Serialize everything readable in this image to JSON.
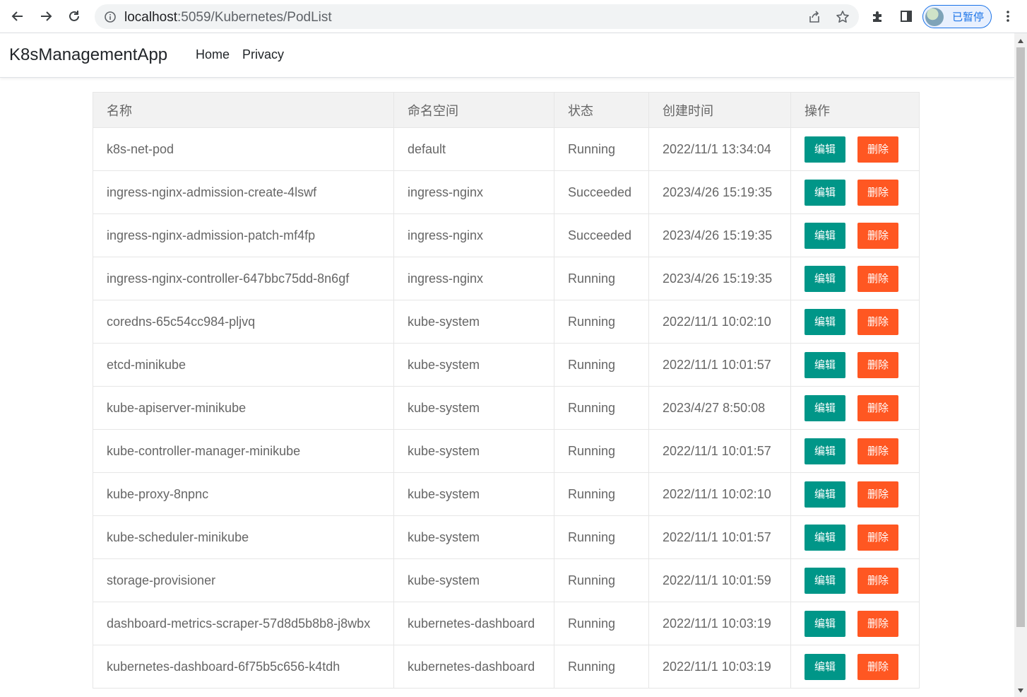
{
  "browser": {
    "url_host": "localhost",
    "url_path": ":5059/Kubernetes/PodList",
    "profile_label": "已暂停"
  },
  "navbar": {
    "brand": "K8sManagementApp",
    "links": [
      "Home",
      "Privacy"
    ]
  },
  "table": {
    "headers": [
      "名称",
      "命名空间",
      "状态",
      "创建时间",
      "操作"
    ],
    "edit_label": "编辑",
    "delete_label": "删除",
    "rows": [
      {
        "name": "k8s-net-pod",
        "namespace": "default",
        "status": "Running",
        "created": "2022/11/1 13:34:04"
      },
      {
        "name": "ingress-nginx-admission-create-4lswf",
        "namespace": "ingress-nginx",
        "status": "Succeeded",
        "created": "2023/4/26 15:19:35"
      },
      {
        "name": "ingress-nginx-admission-patch-mf4fp",
        "namespace": "ingress-nginx",
        "status": "Succeeded",
        "created": "2023/4/26 15:19:35"
      },
      {
        "name": "ingress-nginx-controller-647bbc75dd-8n6gf",
        "namespace": "ingress-nginx",
        "status": "Running",
        "created": "2023/4/26 15:19:35"
      },
      {
        "name": "coredns-65c54cc984-pljvq",
        "namespace": "kube-system",
        "status": "Running",
        "created": "2022/11/1 10:02:10"
      },
      {
        "name": "etcd-minikube",
        "namespace": "kube-system",
        "status": "Running",
        "created": "2022/11/1 10:01:57"
      },
      {
        "name": "kube-apiserver-minikube",
        "namespace": "kube-system",
        "status": "Running",
        "created": "2023/4/27 8:50:08"
      },
      {
        "name": "kube-controller-manager-minikube",
        "namespace": "kube-system",
        "status": "Running",
        "created": "2022/11/1 10:01:57"
      },
      {
        "name": "kube-proxy-8npnc",
        "namespace": "kube-system",
        "status": "Running",
        "created": "2022/11/1 10:02:10"
      },
      {
        "name": "kube-scheduler-minikube",
        "namespace": "kube-system",
        "status": "Running",
        "created": "2022/11/1 10:01:57"
      },
      {
        "name": "storage-provisioner",
        "namespace": "kube-system",
        "status": "Running",
        "created": "2022/11/1 10:01:59"
      },
      {
        "name": "dashboard-metrics-scraper-57d8d5b8b8-j8wbx",
        "namespace": "kubernetes-dashboard",
        "status": "Running",
        "created": "2022/11/1 10:03:19"
      },
      {
        "name": "kubernetes-dashboard-6f75b5c656-k4tdh",
        "namespace": "kubernetes-dashboard",
        "status": "Running",
        "created": "2022/11/1 10:03:19"
      }
    ]
  },
  "icons": {
    "back": "back-arrow-icon",
    "forward": "forward-arrow-icon",
    "reload": "reload-icon",
    "site_info": "info-icon",
    "share": "share-icon",
    "bookmark": "star-icon",
    "extensions": "puzzle-icon",
    "side_panel": "side-panel-icon",
    "menu": "kebab-menu-icon"
  },
  "colors": {
    "edit_button": "#009688",
    "delete_button": "#ff5722",
    "header_bg": "#f2f2f2",
    "profile_accent": "#1a73e8"
  }
}
